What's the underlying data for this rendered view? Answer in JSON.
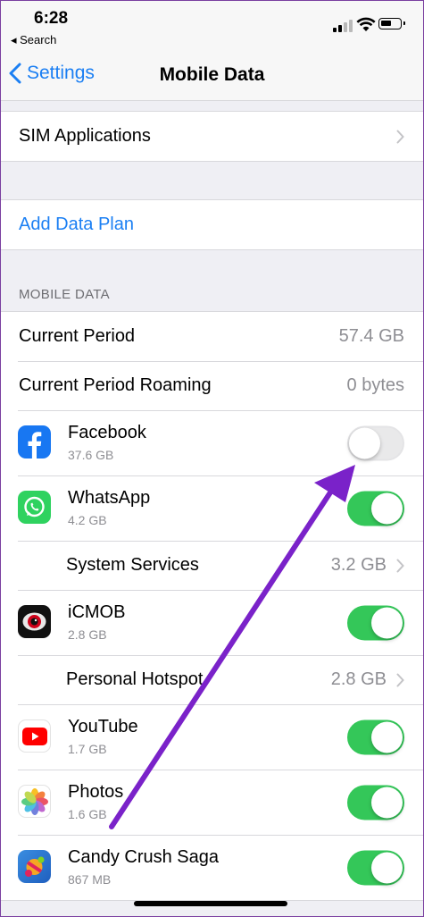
{
  "status": {
    "time": "6:28",
    "back_app": "◂ Search"
  },
  "nav": {
    "back_label": "Settings",
    "title": "Mobile Data"
  },
  "sim_applications": {
    "label": "SIM Applications"
  },
  "add_data_plan": {
    "label": "Add Data Plan"
  },
  "section_header": "MOBILE DATA",
  "usage": {
    "current_period": {
      "label": "Current Period",
      "value": "57.4 GB"
    },
    "current_period_roaming": {
      "label": "Current Period Roaming",
      "value": "0 bytes"
    }
  },
  "apps": [
    {
      "name": "Facebook",
      "size": "37.6 GB",
      "enabled": false,
      "icon": "facebook-icon"
    },
    {
      "name": "WhatsApp",
      "size": "4.2 GB",
      "enabled": true,
      "icon": "whatsapp-icon"
    },
    {
      "name": "System Services",
      "value": "3.2 GB"
    },
    {
      "name": "iCMOB",
      "size": "2.8 GB",
      "enabled": true,
      "icon": "icmob-icon"
    },
    {
      "name": "Personal Hotspot",
      "value": "2.8 GB"
    },
    {
      "name": "YouTube",
      "size": "1.7 GB",
      "enabled": true,
      "icon": "youtube-icon"
    },
    {
      "name": "Photos",
      "size": "1.6 GB",
      "enabled": true,
      "icon": "photos-icon"
    },
    {
      "name": "Candy Crush Saga",
      "size": "867 MB",
      "enabled": true,
      "icon": "candy-crush-icon"
    }
  ],
  "colors": {
    "accent": "#1b7ff3",
    "toggle_on": "#34c759",
    "annotation_arrow": "#7a22c9"
  }
}
